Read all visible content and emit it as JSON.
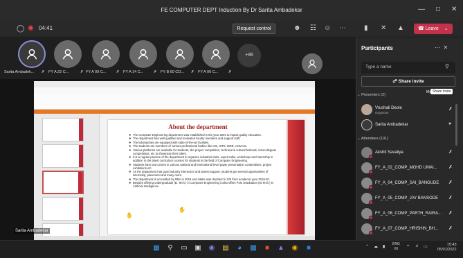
{
  "window": {
    "title": "FE COMPUTER DEPT Induction By Dr Sarita Ambadekar",
    "minimize": "—",
    "maximize": "□",
    "close": "✕"
  },
  "toolbar": {
    "timer": "04:41",
    "request_control": "Request control",
    "leave": "Leave",
    "accent_leave": "#c4314b"
  },
  "gallery": {
    "participants": [
      {
        "label": "Sarita Ambadek..."
      },
      {
        "label": "FY A 22 C..."
      },
      {
        "label": "FY A 09 C..."
      },
      {
        "label": "FY A 14 C..."
      },
      {
        "label": "FY B 60 CO..."
      },
      {
        "label": "FY A 06 C..."
      }
    ],
    "more_count": "+96"
  },
  "stage": {
    "presenter_name": "Sarita Ambadekar"
  },
  "slide": {
    "title": "About the department",
    "bullets": [
      "The Computer Engineering department was established in the year 2004 to impart quality education.",
      "The department has well qualified and motivated faculty members and support staff.",
      "The laboratories are equipped with state-of-the-art facilities.",
      "The students are members of various professional bodies like CSI, ISTE, IEEE, ACM etc.",
      "Various platforms are available for students, like project competition, technical & cultural festivals, intercollegiate competitions, etc to showcase their talent.",
      "It is a regular practice of the department to organize industrial visits, expert talks, workshops and internship in addition to the latest curriculum courses for students in the field of Computer Engineering.",
      "Students have won prizes in various national and international level paper presentation competitions, project exhibitions etc.",
      "As the department has good industry interaction and alumni support, students get several opportunities of internship, placement and many more.",
      "The department is accredited by NBA in 2018 and intake was doubled to 120 from academic year 2019-20.",
      "Besides offering undergraduate (B. Tech.) in Computer Engineering it also offers Post Graduation (M.Tech.) in Artificial Intelligence."
    ],
    "accent": "#c0283b"
  },
  "panel": {
    "title": "Participants",
    "search_placeholder": "Type a name",
    "share_invite": "Share invite",
    "tooltip": "Share invite",
    "mute_all": "Mu",
    "presenters_header": "Presenters (2)",
    "attendees_header": "Attendees (101)",
    "presenters": [
      {
        "name": "Vrushali Deole",
        "role": "Organizer"
      },
      {
        "name": "Sarita Ambadekar",
        "role": ""
      }
    ],
    "attendees": [
      {
        "name": "Akshit Savaliya"
      },
      {
        "name": "FY_A_02_COMP_MOHD UMAI..."
      },
      {
        "name": "FY_A_04_COMP_SAI_BANGUDE"
      },
      {
        "name": "FY_A_05_COMP_JAY BANSODE"
      },
      {
        "name": "FY_A_06_COMP_PARTH_RAIRA..."
      },
      {
        "name": "FY_A_07_COMP_HRISHIN_BH..."
      }
    ]
  },
  "taskbar": {
    "lang": "ENG",
    "region": "IN",
    "time": "15:43",
    "date": "05/01/2022"
  }
}
